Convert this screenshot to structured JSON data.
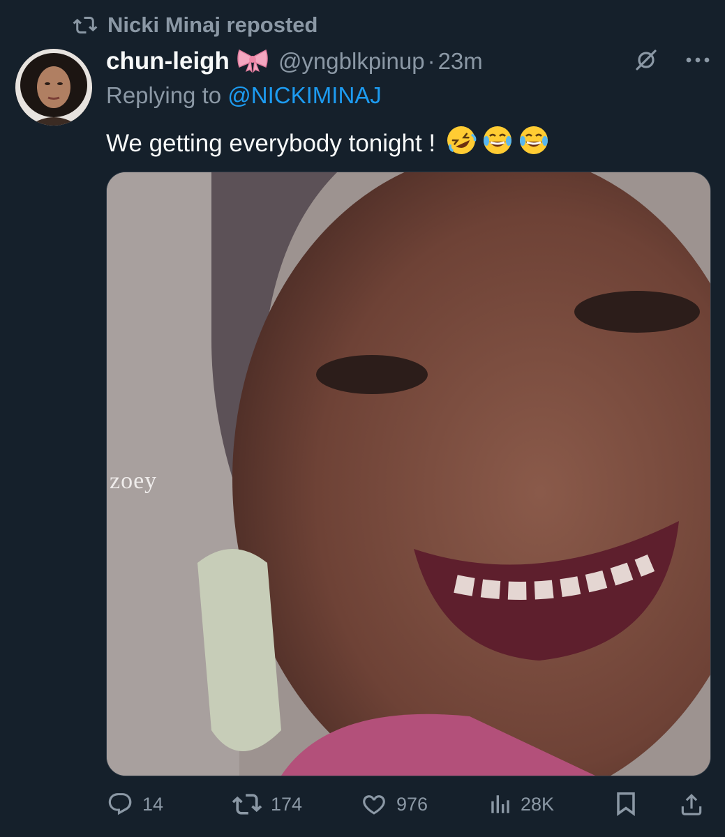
{
  "repost": {
    "label": "Nicki Minaj reposted",
    "icon": "repost-icon"
  },
  "tweet": {
    "display_name": "chun-leigh",
    "name_emoji": "ribbon-bow",
    "handle": "@yngblkpinup",
    "separator": "·",
    "time": "23m",
    "reply_prefix": "Replying to",
    "reply_to": "@NICKIMINAJ",
    "text": "We getting everybody tonight !",
    "text_emojis": [
      "rolling-on-floor-laughing",
      "tears-of-joy",
      "tears-of-joy"
    ],
    "media": {
      "watermark": "zoey"
    }
  },
  "actions": {
    "reply_count": "14",
    "repost_count": "174",
    "like_count": "976",
    "views_count": "28K"
  },
  "colors": {
    "background": "#15202b",
    "text_primary": "#f7f9f9",
    "text_secondary": "#8b98a5",
    "accent": "#1d9bf0"
  }
}
